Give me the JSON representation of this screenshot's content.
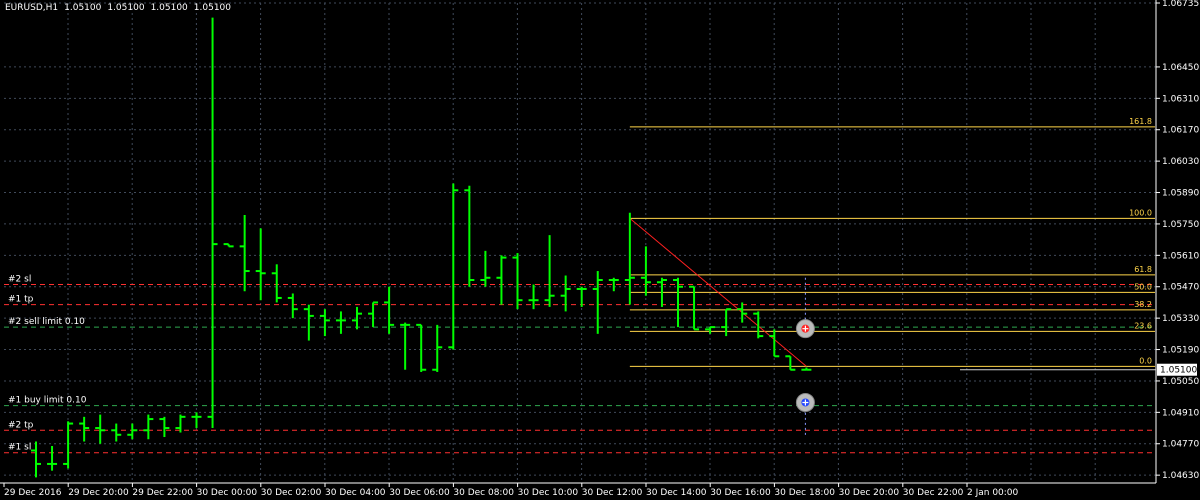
{
  "header": {
    "symbol_tf": "EURUSD,H1",
    "ohlc": [
      "1.05100",
      "1.05100",
      "1.05100",
      "1.05100"
    ]
  },
  "colors": {
    "background": "#000000",
    "grid": "#404a5a",
    "candle": "#00ff00",
    "axis": "#ffffff",
    "fibo": "#ffd54a",
    "sl": "#ff3030",
    "tp": "#ff3030",
    "pending": "#2fa84f",
    "trendline": "#ff2020",
    "price_tag_bg": "#ffffff",
    "price_tag_text": "#000000"
  },
  "chart_data": {
    "type": "ohlc",
    "symbol": "EURUSD",
    "timeframe": "H1",
    "ylim": [
      1.04595,
      1.06735
    ],
    "price_ticks": [
      "1.06735",
      "1.06450",
      "1.06310",
      "1.06170",
      "1.06030",
      "1.05890",
      "1.05750",
      "1.05610",
      "1.05470",
      "1.05330",
      "1.05190",
      "1.05050",
      "1.04910",
      "1.04770",
      "1.04630"
    ],
    "x_labels": [
      "29 Dec 2016",
      "29 Dec 20:00",
      "29 Dec 22:00",
      "30 Dec 00:00",
      "30 Dec 02:00",
      "30 Dec 04:00",
      "30 Dec 06:00",
      "30 Dec 08:00",
      "30 Dec 10:00",
      "30 Dec 12:00",
      "30 Dec 14:00",
      "30 Dec 16:00",
      "30 Dec 18:00",
      "30 Dec 20:00",
      "30 Dec 22:00",
      "2 Jan 00:00"
    ],
    "current_price": "1.05100",
    "bars": [
      {
        "o": 1.0474,
        "h": 1.0478,
        "l": 1.0462,
        "c": 1.0468
      },
      {
        "o": 1.0468,
        "h": 1.0476,
        "l": 1.0465,
        "c": 1.0468
      },
      {
        "o": 1.0468,
        "h": 1.0487,
        "l": 1.0466,
        "c": 1.0486
      },
      {
        "o": 1.0486,
        "h": 1.0489,
        "l": 1.0478,
        "c": 1.0484
      },
      {
        "o": 1.0484,
        "h": 1.049,
        "l": 1.0477,
        "c": 1.0483
      },
      {
        "o": 1.0483,
        "h": 1.0486,
        "l": 1.0478,
        "c": 1.0481
      },
      {
        "o": 1.0481,
        "h": 1.0486,
        "l": 1.0479,
        "c": 1.0483
      },
      {
        "o": 1.0483,
        "h": 1.049,
        "l": 1.0479,
        "c": 1.0488
      },
      {
        "o": 1.0488,
        "h": 1.0489,
        "l": 1.048,
        "c": 1.0484
      },
      {
        "o": 1.0484,
        "h": 1.049,
        "l": 1.0482,
        "c": 1.0489
      },
      {
        "o": 1.0489,
        "h": 1.0491,
        "l": 1.0484,
        "c": 1.0489
      },
      {
        "o": 1.0489,
        "h": 1.0667,
        "l": 1.0484,
        "c": 1.0566
      },
      {
        "o": 1.0566,
        "h": 1.0566,
        "l": 1.0565,
        "c": 1.0565
      },
      {
        "o": 1.0565,
        "h": 1.0579,
        "l": 1.0545,
        "c": 1.0554
      },
      {
        "o": 1.0554,
        "h": 1.0573,
        "l": 1.0541,
        "c": 1.0553
      },
      {
        "o": 1.0553,
        "h": 1.0557,
        "l": 1.054,
        "c": 1.0542
      },
      {
        "o": 1.0542,
        "h": 1.0544,
        "l": 1.0533,
        "c": 1.0537
      },
      {
        "o": 1.0537,
        "h": 1.0539,
        "l": 1.0523,
        "c": 1.0534
      },
      {
        "o": 1.0534,
        "h": 1.0537,
        "l": 1.0525,
        "c": 1.0532
      },
      {
        "o": 1.0532,
        "h": 1.0536,
        "l": 1.0526,
        "c": 1.0532
      },
      {
        "o": 1.0532,
        "h": 1.0538,
        "l": 1.0528,
        "c": 1.0535
      },
      {
        "o": 1.0535,
        "h": 1.054,
        "l": 1.0529,
        "c": 1.054
      },
      {
        "o": 1.054,
        "h": 1.0547,
        "l": 1.0526,
        "c": 1.053
      },
      {
        "o": 1.053,
        "h": 1.0531,
        "l": 1.051,
        "c": 1.053
      },
      {
        "o": 1.053,
        "h": 1.053,
        "l": 1.0509,
        "c": 1.051
      },
      {
        "o": 1.051,
        "h": 1.053,
        "l": 1.0509,
        "c": 1.052
      },
      {
        "o": 1.052,
        "h": 1.0593,
        "l": 1.0519,
        "c": 1.059
      },
      {
        "o": 1.059,
        "h": 1.0592,
        "l": 1.0547,
        "c": 1.055
      },
      {
        "o": 1.055,
        "h": 1.0563,
        "l": 1.0547,
        "c": 1.0551
      },
      {
        "o": 1.0551,
        "h": 1.0561,
        "l": 1.0539,
        "c": 1.056
      },
      {
        "o": 1.056,
        "h": 1.0562,
        "l": 1.0537,
        "c": 1.0541
      },
      {
        "o": 1.0541,
        "h": 1.0548,
        "l": 1.0537,
        "c": 1.0541
      },
      {
        "o": 1.0541,
        "h": 1.057,
        "l": 1.0538,
        "c": 1.0543
      },
      {
        "o": 1.0543,
        "h": 1.0552,
        "l": 1.0536,
        "c": 1.0546
      },
      {
        "o": 1.0546,
        "h": 1.0547,
        "l": 1.0538,
        "c": 1.0546
      },
      {
        "o": 1.0546,
        "h": 1.0554,
        "l": 1.0526,
        "c": 1.055
      },
      {
        "o": 1.055,
        "h": 1.0551,
        "l": 1.0545,
        "c": 1.055
      },
      {
        "o": 1.055,
        "h": 1.058,
        "l": 1.0539,
        "c": 1.0551
      },
      {
        "o": 1.0551,
        "h": 1.0565,
        "l": 1.0543,
        "c": 1.0549
      },
      {
        "o": 1.0549,
        "h": 1.0551,
        "l": 1.0538,
        "c": 1.055
      },
      {
        "o": 1.055,
        "h": 1.0551,
        "l": 1.0529,
        "c": 1.0547
      },
      {
        "o": 1.0547,
        "h": 1.0547,
        "l": 1.0528,
        "c": 1.0528
      },
      {
        "o": 1.0528,
        "h": 1.0529,
        "l": 1.0526,
        "c": 1.0529
      },
      {
        "o": 1.0529,
        "h": 1.0537,
        "l": 1.0525,
        "c": 1.0537
      },
      {
        "o": 1.0537,
        "h": 1.054,
        "l": 1.0531,
        "c": 1.0535
      },
      {
        "o": 1.0535,
        "h": 1.0536,
        "l": 1.0524,
        "c": 1.0525
      },
      {
        "o": 1.0525,
        "h": 1.0528,
        "l": 1.0516,
        "c": 1.0516
      },
      {
        "o": 1.0516,
        "h": 1.0516,
        "l": 1.051,
        "c": 1.051
      },
      {
        "o": 1.051,
        "h": 1.0511,
        "l": 1.051,
        "c": 1.051
      }
    ],
    "order_lines": [
      {
        "label": "#2 sl",
        "price": 1.0548,
        "kind": "sl"
      },
      {
        "label": "#1 tp",
        "price": 1.0539,
        "kind": "tp"
      },
      {
        "label": "#2 sell limit 0.10",
        "price": 1.0529,
        "kind": "pending"
      },
      {
        "label": "#1 buy limit 0.10",
        "price": 1.0494,
        "kind": "pending"
      },
      {
        "label": "#2 tp",
        "price": 1.0483,
        "kind": "tp"
      },
      {
        "label": "#1 sl",
        "price": 1.0473,
        "kind": "sl"
      }
    ],
    "fibonacci": {
      "high": 1.05775,
      "low": 1.05115,
      "levels": [
        {
          "label": "161.8",
          "value": 1.06183
        },
        {
          "label": "100.0",
          "value": 1.05775
        },
        {
          "label": "61.8",
          "value": 1.05523
        },
        {
          "label": "50.0",
          "value": 1.05445
        },
        {
          "label": "38.2",
          "value": 1.05367
        },
        {
          "label": "23.6",
          "value": 1.05271
        },
        {
          "label": "0.0",
          "value": 1.05115
        }
      ]
    },
    "trendline": {
      "from": {
        "bar": 37,
        "price": 1.05775
      },
      "to": {
        "bar": 48,
        "price": 1.05115
      }
    },
    "markers": [
      {
        "kind": "sell",
        "price": 1.05283
      },
      {
        "kind": "buy",
        "price": 1.04954
      }
    ]
  }
}
